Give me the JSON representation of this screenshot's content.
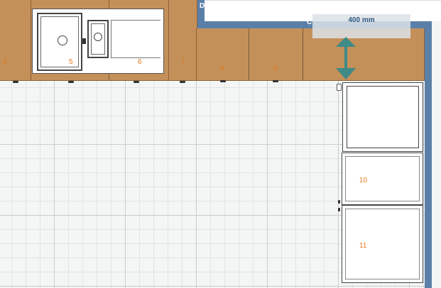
{
  "walls": {
    "labels": {
      "d": "D",
      "c": "C"
    },
    "color": "#5b80a8"
  },
  "cabinets": {
    "color": "#c4905a",
    "labels": {
      "c4": "4",
      "c5": "5",
      "c6": "6",
      "c7": "7",
      "c8": "8",
      "c9": "9",
      "c10": "10",
      "c11": "11"
    }
  },
  "dimension": {
    "label": "400 mm",
    "arrow_color": "#3e8a86"
  },
  "label_color": "#e07a1f"
}
